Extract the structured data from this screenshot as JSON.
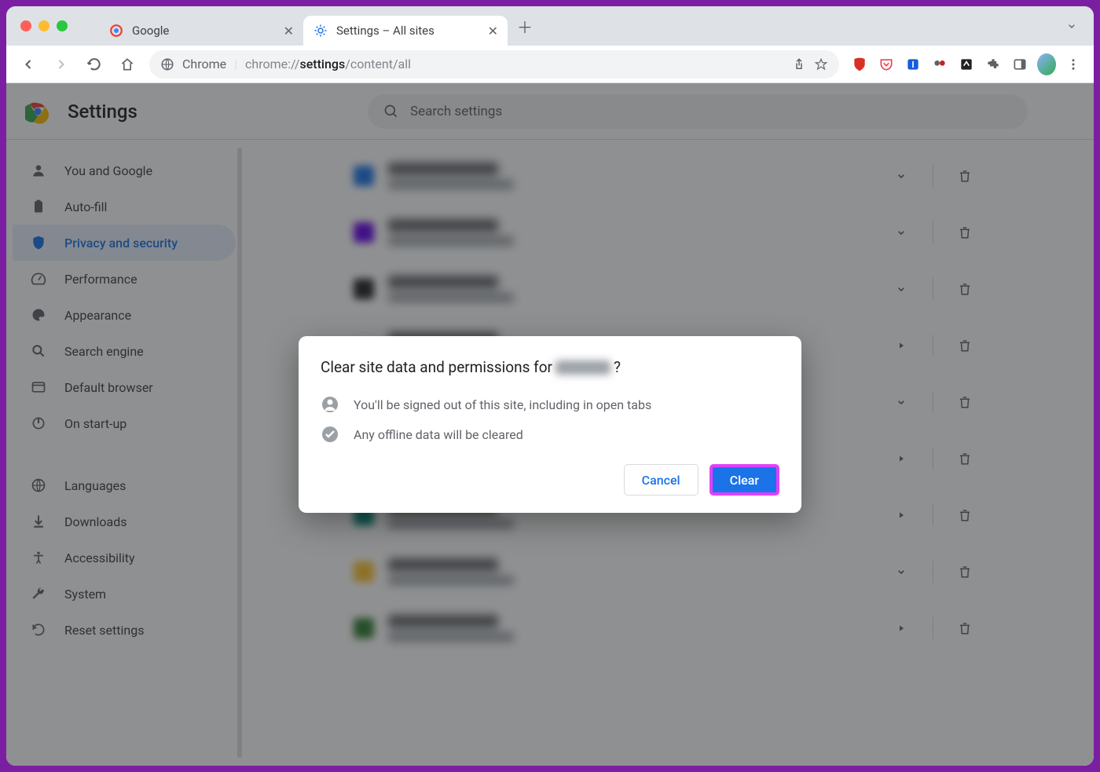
{
  "tabs": [
    {
      "title": "Google",
      "active": false,
      "favicon": "google"
    },
    {
      "title": "Settings – All sites",
      "active": true,
      "favicon": "gear"
    }
  ],
  "omnibox": {
    "scheme": "Chrome",
    "prefix": "chrome://",
    "bold": "settings",
    "suffix": "/content/all"
  },
  "settings_title": "Settings",
  "search": {
    "placeholder": "Search settings"
  },
  "sidebar": [
    {
      "icon": "person",
      "label": "You and Google"
    },
    {
      "icon": "clipboard",
      "label": "Auto-fill"
    },
    {
      "icon": "shield",
      "label": "Privacy and security",
      "selected": true
    },
    {
      "icon": "speed",
      "label": "Performance"
    },
    {
      "icon": "palette",
      "label": "Appearance"
    },
    {
      "icon": "search",
      "label": "Search engine"
    },
    {
      "icon": "browser",
      "label": "Default browser"
    },
    {
      "icon": "power",
      "label": "On start-up"
    },
    {
      "divider": true
    },
    {
      "icon": "globe",
      "label": "Languages"
    },
    {
      "icon": "download",
      "label": "Downloads"
    },
    {
      "icon": "accessibility",
      "label": "Accessibility"
    },
    {
      "icon": "wrench",
      "label": "System"
    },
    {
      "icon": "restore",
      "label": "Reset settings"
    }
  ],
  "dialog": {
    "title_prefix": "Clear site data and permissions for ",
    "title_suffix": "?",
    "line1": "You'll be signed out of this site, including in open tabs",
    "line2": "Any offline data will be cleared",
    "cancel": "Cancel",
    "clear": "Clear"
  }
}
